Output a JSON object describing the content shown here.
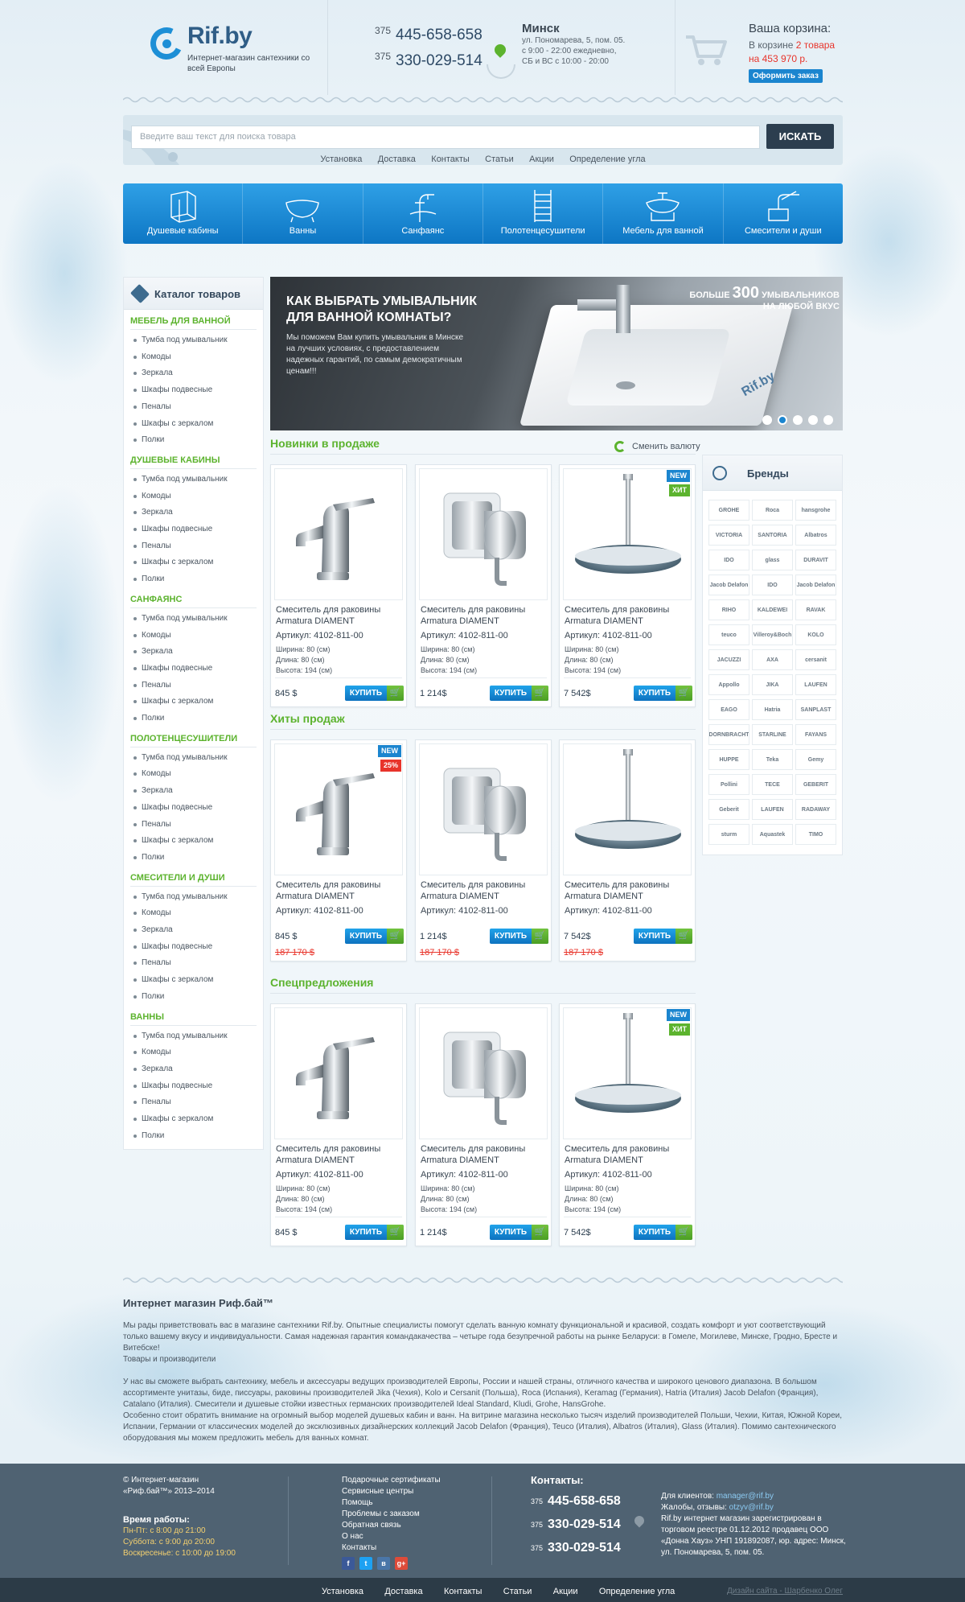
{
  "header": {
    "logo_name": "Rif.by",
    "logo_sub": "Интернет-магазин сантехники со всей Европы",
    "phones": [
      {
        "code": "375",
        "number": "445-658-658"
      },
      {
        "code": "375",
        "number": "330-029-514"
      }
    ],
    "city": "Минск",
    "address_lines": [
      "ул. Пономарева, 5, пом. 05.",
      "с 9:00 - 22:00 ежедневно,",
      "СБ и ВС с 10:00 - 20:00"
    ],
    "cart_title": "Ваша корзина:",
    "cart_prefix": "В корзине",
    "cart_count": "2 товара",
    "cart_sum": "на 453 970 р.",
    "cart_button": "Оформить заказ"
  },
  "search": {
    "placeholder": "Введите ваш текст для поиска товара",
    "button": "ИСКАТЬ",
    "links": [
      "Установка",
      "Доставка",
      "Контакты",
      "Статьи",
      "Акции",
      "Определение угла"
    ]
  },
  "categories": [
    {
      "label": "Душевые кабины",
      "icon": "shower-cabin-icon"
    },
    {
      "label": "Ванны",
      "icon": "bathtub-icon"
    },
    {
      "label": "Санфаянс",
      "icon": "faucet-icon"
    },
    {
      "label": "Полотенцесушители",
      "icon": "towel-rail-icon"
    },
    {
      "label": "Мебель для ванной",
      "icon": "vanity-icon"
    },
    {
      "label": "Смесители и души",
      "icon": "mixer-icon"
    }
  ],
  "sidebar": {
    "title": "Каталог товаров",
    "groups": [
      {
        "title": "МЕБЕЛЬ ДЛЯ ВАННОЙ",
        "items": [
          "Тумба под умывальник",
          "Комоды",
          "Зеркала",
          "Шкафы подвесные",
          "Пеналы",
          "Шкафы с зеркалом",
          "Полки"
        ]
      },
      {
        "title": "ДУШЕВЫЕ КАБИНЫ",
        "items": [
          "Тумба под умывальник",
          "Комоды",
          "Зеркала",
          "Шкафы подвесные",
          "Пеналы",
          "Шкафы с зеркалом",
          "Полки"
        ]
      },
      {
        "title": "САНФАЯНС",
        "items": [
          "Тумба под умывальник",
          "Комоды",
          "Зеркала",
          "Шкафы подвесные",
          "Пеналы",
          "Шкафы с зеркалом",
          "Полки"
        ]
      },
      {
        "title": "ПОЛОТЕНЦЕСУШИТЕЛИ",
        "items": [
          "Тумба под умывальник",
          "Комоды",
          "Зеркала",
          "Шкафы подвесные",
          "Пеналы",
          "Шкафы с зеркалом",
          "Полки"
        ]
      },
      {
        "title": "СМЕСИТЕЛИ И ДУШИ",
        "items": [
          "Тумба под умывальник",
          "Комоды",
          "Зеркала",
          "Шкафы подвесные",
          "Пеналы",
          "Шкафы с зеркалом",
          "Полки"
        ]
      },
      {
        "title": "ВАННЫ",
        "items": [
          "Тумба под умывальник",
          "Комоды",
          "Зеркала",
          "Шкафы подвесные",
          "Пеналы",
          "Шкафы с зеркалом",
          "Полки"
        ]
      }
    ]
  },
  "banner": {
    "title": "КАК ВЫБРАТЬ УМЫВАЛЬНИК ДЛЯ ВАННОЙ КОМНАТЫ?",
    "text": "Мы поможем Вам купить умывальник в Минске на лучших условиях, с предоставлением надежных гарантий, по самым демократичным ценам!!!",
    "promo_pre": "БОЛЬШЕ",
    "promo_number": "300",
    "promo_post": "УМЫВАЛЬНИКОВ",
    "promo_line2": "НА ЛЮБОЙ ВКУС",
    "brand": "Rif.by",
    "slides": 5,
    "active_slide": 2
  },
  "currency_switch": "Сменить валюту",
  "buy_label": "КУПИТЬ",
  "sections": [
    {
      "title": "Новинки в продаже",
      "products": [
        {
          "name": "Смеситель для раковины Armatura DIAMENT",
          "article": "Артикул: 4102-811-00",
          "specs": [
            "Ширина: 80 (см)",
            "Длина: 80 (см)",
            "Высота: 194 (см)"
          ],
          "price": "845 $",
          "badges": []
        },
        {
          "name": "Смеситель для раковины Armatura DIAMENT",
          "article": "Артикул: 4102-811-00",
          "specs": [
            "Ширина: 80 (см)",
            "Длина: 80 (см)",
            "Высота: 194 (см)"
          ],
          "price": "1 214$",
          "badges": []
        },
        {
          "name": "Смеситель для раковины Armatura DIAMENT",
          "article": "Артикул: 4102-811-00",
          "specs": [
            "Ширина: 80 (см)",
            "Длина: 80 (см)",
            "Высота: 194 (см)"
          ],
          "price": "7 542$",
          "badges": [
            "NEW",
            "ХИТ"
          ]
        }
      ]
    },
    {
      "title": "Хиты продаж",
      "products": [
        {
          "name": "Смеситель для раковины Armatura DIAMENT",
          "article": "Артикул: 4102-811-00",
          "price": "845 $",
          "old_price": "187 170 $",
          "badges": [
            "NEW",
            "25%"
          ]
        },
        {
          "name": "Смеситель для раковины Armatura DIAMENT",
          "article": "Артикул: 4102-811-00",
          "price": "1 214$",
          "old_price": "187 170 $",
          "badges": []
        },
        {
          "name": "Смеситель для раковины Armatura DIAMENT",
          "article": "Артикул: 4102-811-00",
          "price": "7 542$",
          "old_price": "187 170 $",
          "badges": []
        }
      ]
    },
    {
      "title": "Спецпредложения",
      "products": [
        {
          "name": "Смеситель для раковины Armatura DIAMENT",
          "article": "Артикул: 4102-811-00",
          "specs": [
            "Ширина: 80 (см)",
            "Длина: 80 (см)",
            "Высота: 194 (см)"
          ],
          "price": "845 $",
          "badges": []
        },
        {
          "name": "Смеситель для раковины Armatura DIAMENT",
          "article": "Артикул: 4102-811-00",
          "specs": [
            "Ширина: 80 (см)",
            "Длина: 80 (см)",
            "Высота: 194 (см)"
          ],
          "price": "1 214$",
          "badges": []
        },
        {
          "name": "Смеситель для раковины Armatura DIAMENT",
          "article": "Артикул: 4102-811-00",
          "specs": [
            "Ширина: 80 (см)",
            "Длина: 80 (см)",
            "Высота: 194 (см)"
          ],
          "price": "7 542$",
          "badges": [
            "NEW",
            "ХИТ"
          ]
        }
      ]
    }
  ],
  "brands": {
    "title": "Бренды",
    "items": [
      "GROHE",
      "Roca",
      "hansgrohe",
      "VICTORIA",
      "SANTORIA",
      "Albatros",
      "IDO",
      "glass",
      "DURAVIT",
      "Jacob Delafon",
      "IDO",
      "Jacob Delafon",
      "RIHO",
      "KALDEWEI",
      "RAVAK",
      "teuco",
      "Villeroy&Boch",
      "KOLO",
      "JACUZZI",
      "AXA",
      "cersanit",
      "Appollo",
      "JIKA",
      "LAUFEN",
      "EAGO",
      "Hatria",
      "SANPLAST",
      "DORNBRACHT",
      "STARLINE",
      "FAYANS",
      "HUPPE",
      "Teka",
      "Gemy",
      "Pollini",
      "TECE",
      "GEBERIT",
      "Geberit",
      "LAUFEN",
      "RADAWAY",
      "sturm",
      "Aquastek",
      "TIMO"
    ]
  },
  "about": {
    "title": "Интернет магазин Риф.бай™",
    "p1": "Мы рады приветствовать вас в магазине сантехники Rif.by. Опытные специалисты помогут сделать ванную комнату функциональной и красивой, создать комфорт и уют соответствующий только вашему вкусу и индивидуальности. Самая надежная гарантия командакачества – четыре года безупречной работы на рынке Беларуси: в Гомеле, Могилеве, Минске, Гродно, Бресте и Витебске!",
    "p1b": "Товары и производители",
    "p2": "У нас вы сможете выбрать сантехнику, мебель и аксессуары ведущих производителей Европы, России и нашей страны, отличного качества и широкого ценового диапазона. В большом ассортименте унитазы, биде, писсуары, раковины производителей Jika (Чехия), Kolo и Cersanit (Польша), Roca (Испания), Keramag (Германия), Hatria (Италия) Jacob Delafon (Франция), Catalano (Италия). Смесители и душевые стойки известных германских производителей Ideal Standard, Kludi, Grohe, HansGrohe.",
    "p3": "Особенно стоит обратить внимание на огромный выбор моделей душевых кабин и ванн. На витрине магазина несколько тысяч изделий производителей Польши, Чехии, Китая, Южной Кореи, Испании, Германии от классических моделей до эксклюзивных дизайнерских коллекций Jacob Delafon (Франция), Teuco (Италия), Albatros (Италия), Glass (Италия). Помимо сантехнического оборудования мы можем предложить мебель для ванных комнат."
  },
  "footer": {
    "copyright": "© Интернет-магазин «Риф.бай™» 2013–2014",
    "hours_title": "Время работы:",
    "hours": [
      "Пн-Пт: с 8:00 до 21:00",
      "Суббота: с 9:00 до 20:00",
      "Воскресенье: с 10:00 до 19:00"
    ],
    "links": [
      "Подарочные сертификаты",
      "Сервисные центры",
      "Помощь",
      "Проблемы с заказом",
      "Обратная связь",
      "О нас",
      "Контакты"
    ],
    "social": [
      "f",
      "t",
      "в",
      "g+"
    ],
    "contacts_title": "Контакты:",
    "phones": [
      {
        "code": "375",
        "number": "445-658-658"
      },
      {
        "code": "375",
        "number": "330-029-514"
      },
      {
        "code": "375",
        "number": "330-029-514"
      }
    ],
    "clients_label": "Для клиентов:",
    "clients_email": "manager@rif.by",
    "complaints_label": "Жалобы, отзывы:",
    "complaints_email": "otzyv@rif.by",
    "legal": "Rif.by интернет магазин зарегистрирован в торговом реестре 01.12.2012 продавец ООО «Донна Хауз» УНП 191892087, юр. адрес: Минск, ул. Пономарева, 5, пом. 05.",
    "bottom_links": [
      "Установка",
      "Доставка",
      "Контакты",
      "Статьи",
      "Акции",
      "Определение угла"
    ],
    "design": "Дизайн сайта - Шарбенко Олег"
  }
}
